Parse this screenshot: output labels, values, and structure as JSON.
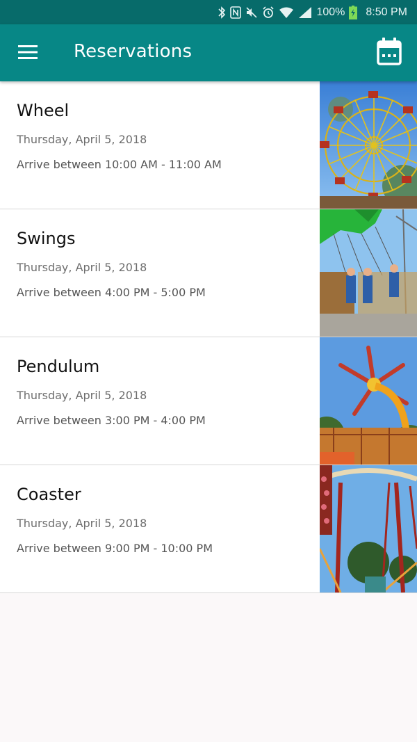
{
  "status_bar": {
    "battery_percent": "100%",
    "time": "8:50 PM",
    "icons": [
      "bluetooth-icon",
      "nfc-icon",
      "mute-icon",
      "alarm-icon",
      "wifi-icon",
      "signal-icon",
      "battery-charging-icon"
    ]
  },
  "app_bar": {
    "title": "Reservations",
    "menu_icon": "hamburger-menu-icon",
    "action_icon": "calendar-icon",
    "color": "#078786",
    "status_color": "#076b6a"
  },
  "reservations": [
    {
      "name": "Wheel",
      "date": "Thursday, April 5, 2018",
      "arrival": "Arrive between 10:00 AM - 11:00 AM",
      "thumbnail": "ferris-wheel-photo"
    },
    {
      "name": "Swings",
      "date": "Thursday, April 5, 2018",
      "arrival": "Arrive between 4:00 PM - 5:00 PM",
      "thumbnail": "swing-ride-photo"
    },
    {
      "name": "Pendulum",
      "date": "Thursday, April 5, 2018",
      "arrival": "Arrive between 3:00 PM - 4:00 PM",
      "thumbnail": "pendulum-ride-photo"
    },
    {
      "name": "Coaster",
      "date": "Thursday, April 5, 2018",
      "arrival": "Arrive between 9:00 PM - 10:00 PM",
      "thumbnail": "roller-coaster-photo"
    }
  ]
}
